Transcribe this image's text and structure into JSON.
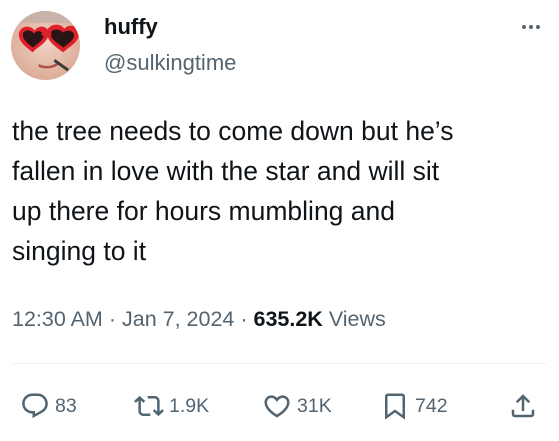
{
  "author": {
    "display_name": "huffy",
    "handle": "@sulkingtime"
  },
  "tweet": {
    "text": "the tree needs to come down but he’s\nfallen in love with the star and will sit\nup there for hours mumbling and\nsinging to it"
  },
  "meta": {
    "time": "12:30 AM",
    "sep1": "·",
    "date": "Jan 7, 2024",
    "sep2": "·",
    "views_count": "635.2K",
    "views_label": "Views"
  },
  "actions": {
    "replies": "83",
    "reposts": "1.9K",
    "likes": "31K",
    "bookmarks": "742"
  },
  "icons": {
    "more": "more-horizontal-icon",
    "reply": "reply-icon",
    "repost": "repost-icon",
    "like": "heart-icon",
    "bookmark": "bookmark-icon",
    "share": "share-icon"
  },
  "colors": {
    "text": "#0f1419",
    "secondary": "#536471",
    "divider": "#eff3f4",
    "avatar_glasses": "#e0202a"
  }
}
